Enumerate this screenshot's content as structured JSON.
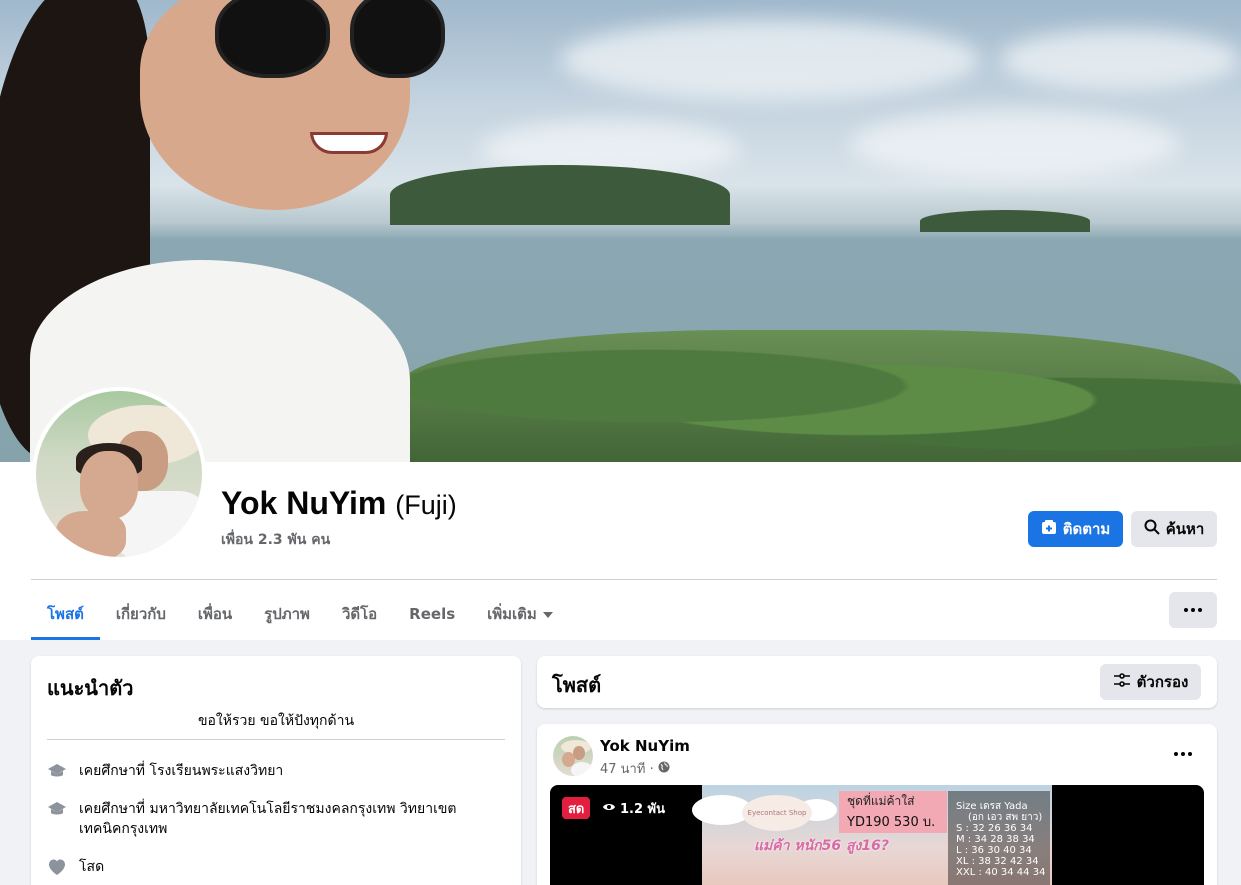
{
  "profile": {
    "name": "Yok NuYim",
    "alt_name": "(Fuji)",
    "friends": "เพื่อน 2.3 พัน คน"
  },
  "actions": {
    "follow_label": "ติดตาม",
    "search_label": "ค้นหา"
  },
  "tabs": [
    {
      "label": "โพสต์",
      "active": true
    },
    {
      "label": "เกี่ยวกับ"
    },
    {
      "label": "เพื่อน"
    },
    {
      "label": "รูปภาพ"
    },
    {
      "label": "วิดีโอ"
    },
    {
      "label": "Reels"
    },
    {
      "label": "เพิ่มเติม"
    }
  ],
  "intro": {
    "title": "แนะนำตัว",
    "bio": "ขอให้รวย ขอให้ปังทุกด้าน",
    "details": [
      {
        "icon": "graduation-cap-icon",
        "text": "เคยศึกษาที่ โรงเรียนพระแสงวิทยา"
      },
      {
        "icon": "graduation-cap-icon",
        "text": "เคยศึกษาที่ มหาวิทยาลัยเทคโนโลยีราชมงคลกรุงเทพ วิทยาเขตเทคนิคกรุงเทพ"
      },
      {
        "icon": "heart-icon",
        "text": "โสด"
      }
    ]
  },
  "posts_section": {
    "title": "โพสต์",
    "filter_label": "ตัวกรอง"
  },
  "post": {
    "author": "Yok NuYim",
    "time": "47 นาที ·",
    "privacy_icon": "globe-icon",
    "live_badge": "สด",
    "views": "1.2 พัน",
    "video": {
      "shop": "Eyecontact Shop",
      "price_line1": "ชุดที่แม่ค้าใส่",
      "price_line2": "YD190  530 บ.",
      "overlay": "แม่ค้า หนัก56 สูง16?",
      "size_title": "Size เดรส Yada",
      "size_sub": "(อก เอว สพ ยาว)",
      "sizes": [
        "S : 32 26 36  34",
        "M : 34 28 38  34",
        "L : 36 30 40  34",
        "XL : 38 32 42 34",
        "XXL : 40 34 44 34"
      ]
    }
  },
  "colors": {
    "accent": "#1b74e4",
    "background": "#f0f2f5",
    "secondary_text": "#65676b",
    "live_red": "#e41e3f"
  }
}
